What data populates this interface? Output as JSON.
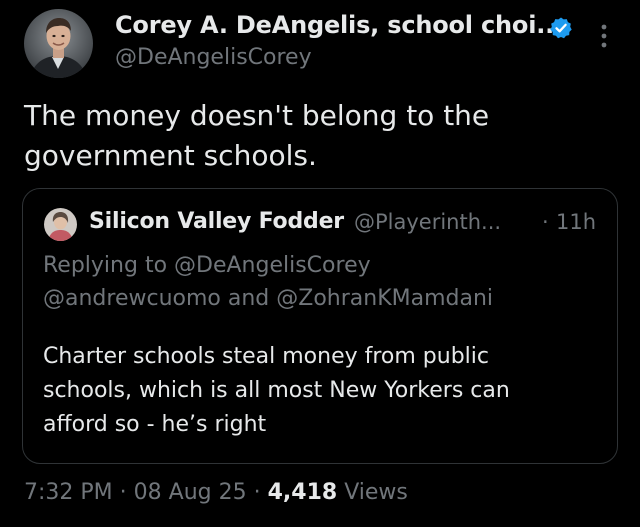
{
  "author": {
    "display_name": "Corey A. DeAngelis, school choi...",
    "handle": "@DeAngelisCorey",
    "verified_color": "#1d9bf0"
  },
  "tweet_text_lines": [
    "The money doesn't belong to the",
    "government schools."
  ],
  "quoted": {
    "display_name": "Silicon Valley Fodder",
    "handle": "@Playerinth...",
    "separator": "·",
    "time": "11h",
    "replying_prefix": "Replying to",
    "replying_first": "@DeAngelisCorey",
    "replying_second": "@andrewcuomo",
    "replying_and": "and",
    "replying_third": "@ZohranKMamdani",
    "body_lines": [
      "Charter schools steal money from public",
      "schools, which is all most New Yorkers can",
      "afford so - he’s right"
    ]
  },
  "meta": {
    "time": "7:32 PM",
    "sep1": "·",
    "date": "08 Aug 25",
    "sep2": "·",
    "views_count": "4,418",
    "views_label": "Views"
  },
  "icons": {
    "verified": "verified-badge-icon",
    "more": "more-dots-icon"
  }
}
